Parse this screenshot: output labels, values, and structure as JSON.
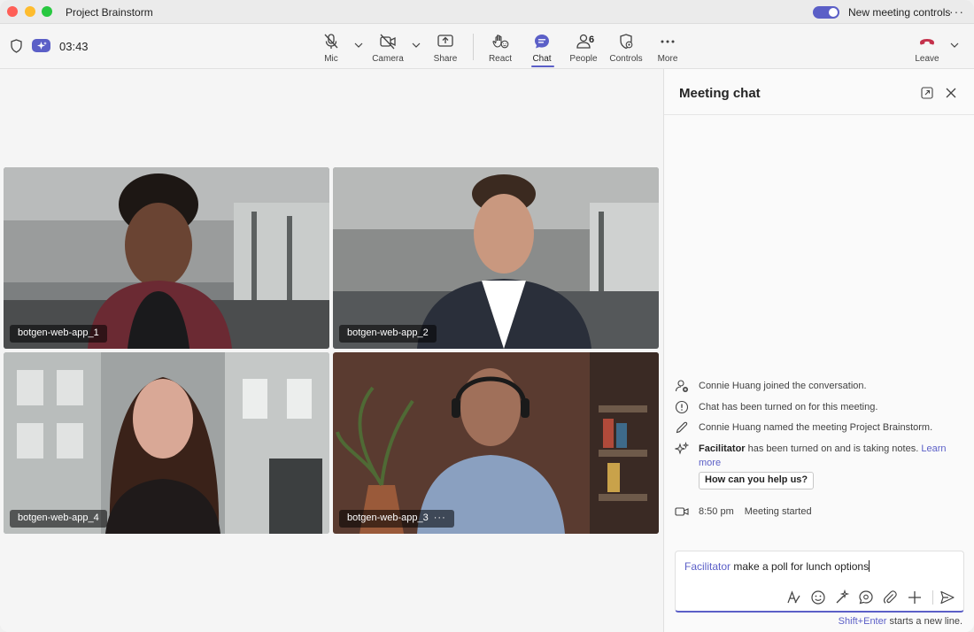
{
  "window": {
    "title": "Project Brainstorm",
    "new_controls_label": "New meeting controls",
    "more_label": "···"
  },
  "meeting": {
    "timer": "03:43"
  },
  "toolbar": {
    "mic": "Mic",
    "camera": "Camera",
    "share": "Share",
    "react": "React",
    "chat": "Chat",
    "people": "People",
    "people_count": "6",
    "controls": "Controls",
    "more": "More",
    "leave": "Leave"
  },
  "participants": [
    {
      "name": "botgen-web-app_1"
    },
    {
      "name": "botgen-web-app_2"
    },
    {
      "name": "botgen-web-app_4"
    },
    {
      "name": "botgen-web-app_3",
      "more": "···"
    }
  ],
  "chat": {
    "title": "Meeting chat",
    "events": {
      "joined": "Connie Huang joined the conversation.",
      "chat_on": "Chat has been turned on for this meeting.",
      "named": "Connie Huang named the meeting Project Brainstorm.",
      "facilitator_name": "Facilitator",
      "facilitator_text": " has been turned on and is taking notes. ",
      "learn_more": "Learn more",
      "help_button": "How can you help us?",
      "started_time": "8:50 pm",
      "started_text": "Meeting started"
    },
    "composer": {
      "mention": "Facilitator",
      "text": " make a poll for lunch options"
    },
    "hint_key": "Shift+Enter",
    "hint_text": " starts a new line."
  },
  "colors": {
    "accent": "#5b5fc7",
    "leave": "#c4314b"
  },
  "icons": [
    "shield-icon",
    "sparkle-badge-icon",
    "mic-off-icon",
    "camera-off-icon",
    "share-icon",
    "react-icon",
    "chat-icon",
    "people-icon",
    "controls-icon",
    "more-icon",
    "hangup-icon",
    "popout-icon",
    "close-icon",
    "person-add-icon",
    "info-icon",
    "pencil-icon",
    "sparkle-icon",
    "video-icon",
    "format-icon",
    "emoji-icon",
    "copilot-icon",
    "loop-icon",
    "attach-icon",
    "plus-icon",
    "send-icon"
  ]
}
